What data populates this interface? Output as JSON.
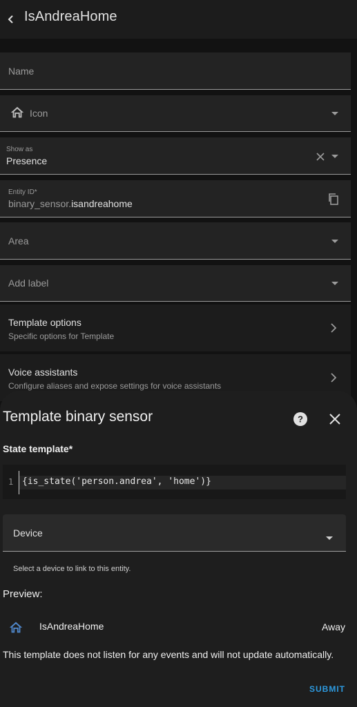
{
  "header": {
    "title": "IsAndreaHome"
  },
  "form": {
    "name_label": "Name",
    "icon_label": "Icon",
    "show_as_label": "Show as",
    "show_as_value": "Presence",
    "entity_id_label": "Entity ID*",
    "entity_id_prefix": "binary_sensor.",
    "entity_id_value": "isandreahome",
    "area_label": "Area",
    "add_label": "Add label",
    "template_options_title": "Template options",
    "template_options_subtitle": "Specific options for Template",
    "voice_title": "Voice assistants",
    "voice_subtitle": "Configure aliases and expose settings for voice assistants"
  },
  "dialog": {
    "title": "Template binary sensor",
    "state_template_label": "State template*",
    "code_line_number": "1",
    "code": "{is_state('person.andrea', 'home')}",
    "device_label": "Device",
    "device_helper": "Select a device to link to this entity.",
    "preview_label": "Preview:",
    "preview_name": "IsAndreaHome",
    "preview_state": "Away",
    "warning": "This template does not listen for any events and will not update automatically.",
    "submit_label": "SUBMIT"
  },
  "icons": [
    "back-icon",
    "home-icon",
    "clear-icon",
    "copy-icon",
    "chevron-down-icon",
    "chevron-right-icon",
    "help-icon",
    "close-icon"
  ],
  "colors": {
    "accent": "#2d9ae0",
    "preview_icon": "#4f86c9"
  }
}
